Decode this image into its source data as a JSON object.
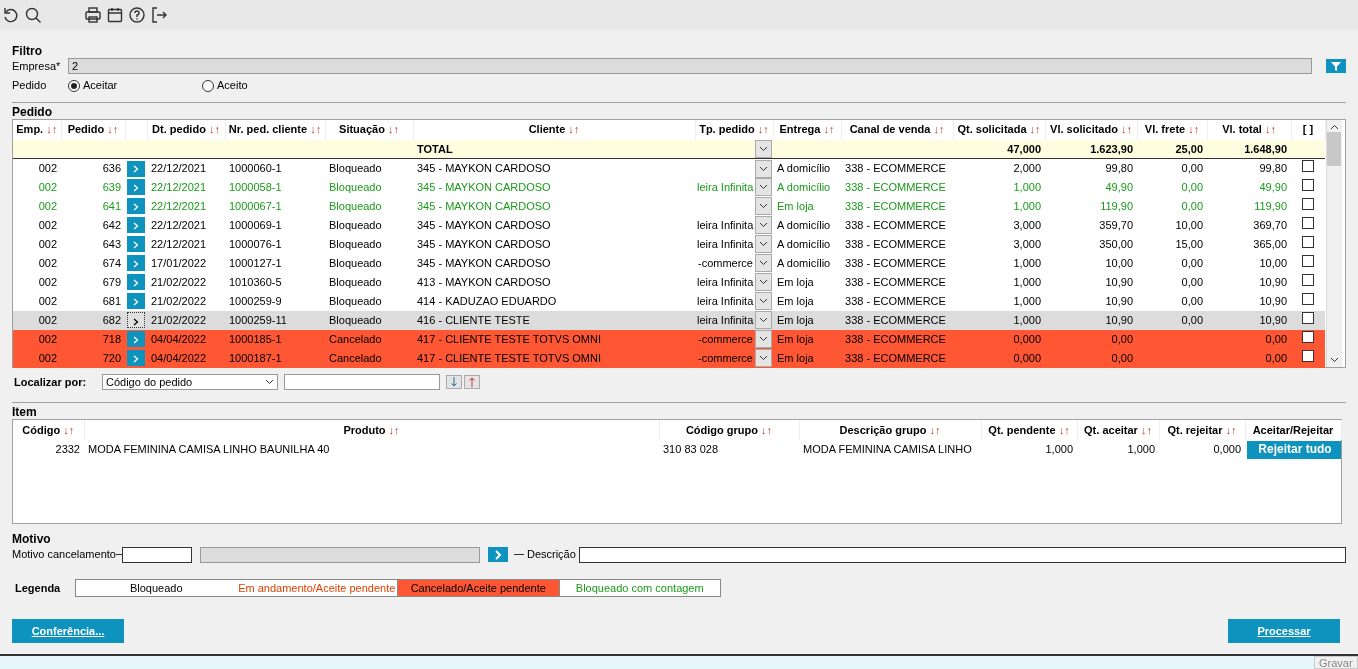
{
  "filter": {
    "title": "Filtro",
    "empresa_label": "Empresa*",
    "empresa_value": "2",
    "pedido_label": "Pedido",
    "options": [
      {
        "label": "Aceitar",
        "selected": true
      },
      {
        "label": "Aceito",
        "selected": false
      }
    ]
  },
  "pedido": {
    "title": "Pedido",
    "columns": [
      {
        "label": "Emp.",
        "sort": "↓↑"
      },
      {
        "label": "Pedido",
        "sort": "↓↑"
      },
      {},
      {
        "label": "Dt. pedido",
        "sort": "↓↑"
      },
      {
        "label": "Nr. ped. cliente",
        "sort": "↓↑"
      },
      {
        "label": "Situação",
        "sort": "↓↑"
      },
      {
        "label": "Cliente",
        "sort": "↓↑"
      },
      {
        "label": "Tp. pedido",
        "sort": "↓↑"
      },
      {
        "label": "Entrega",
        "sort": "↓↑"
      },
      {
        "label": "Canal de venda",
        "sort": "↓↑"
      },
      {
        "label": "Qt. solicitada",
        "sort": "↓↑"
      },
      {
        "label": "Vl. solicitado",
        "sort": "↓↑"
      },
      {
        "label": "Vl. frete",
        "sort": "↓↑"
      },
      {
        "label": "Vl. total",
        "sort": "↓↑"
      },
      {
        "label": "[ ]"
      }
    ],
    "total": {
      "label": "TOTAL",
      "qt": "47,000",
      "vl": "1.623,90",
      "frete": "25,00",
      "total": "1.648,90"
    },
    "rows": [
      {
        "kind": "bloqueado",
        "selected": false,
        "checked": false,
        "emp": "002",
        "pedido": "636",
        "dt": "22/12/2021",
        "nr": "1000060-1",
        "situacao": "Bloqueado",
        "cliente": "345 - MAYKON CARDOSO",
        "entrega": "A domicílio",
        "canal": "338 - ECOMMERCE",
        "qt": "2,000",
        "vl": "99,80",
        "frete": "0,00",
        "total": "99,80"
      },
      {
        "kind": "contagem",
        "selected": false,
        "checked": false,
        "emp": "002",
        "pedido": "639",
        "dt": "22/12/2021",
        "nr": "1000058-1",
        "situacao": "Bloqueado",
        "cliente": "345 - MAYKON CARDOSO",
        "tp": "leira Infinita",
        "entrega": "A domicílio",
        "canal": "338 - ECOMMERCE",
        "qt": "1,000",
        "vl": "49,90",
        "frete": "0,00",
        "total": "49,90"
      },
      {
        "kind": "contagem",
        "selected": false,
        "checked": false,
        "emp": "002",
        "pedido": "641",
        "dt": "22/12/2021",
        "nr": "1000067-1",
        "situacao": "Bloqueado",
        "cliente": "345 - MAYKON CARDOSO",
        "entrega": "Em loja",
        "canal": "338 - ECOMMERCE",
        "qt": "1,000",
        "vl": "119,90",
        "frete": "0,00",
        "total": "119,90"
      },
      {
        "kind": "bloqueado",
        "selected": false,
        "checked": false,
        "emp": "002",
        "pedido": "642",
        "dt": "22/12/2021",
        "nr": "1000069-1",
        "situacao": "Bloqueado",
        "cliente": "345 - MAYKON CARDOSO",
        "tp": "leira Infinita",
        "entrega": "A domicílio",
        "canal": "338 - ECOMMERCE",
        "qt": "3,000",
        "vl": "359,70",
        "frete": "10,00",
        "total": "369,70"
      },
      {
        "kind": "bloqueado",
        "selected": false,
        "checked": false,
        "emp": "002",
        "pedido": "643",
        "dt": "22/12/2021",
        "nr": "1000076-1",
        "situacao": "Bloqueado",
        "cliente": "345 - MAYKON CARDOSO",
        "tp": "leira Infinita",
        "entrega": "A domicílio",
        "canal": "338 - ECOMMERCE",
        "qt": "3,000",
        "vl": "350,00",
        "frete": "15,00",
        "total": "365,00"
      },
      {
        "kind": "bloqueado",
        "selected": false,
        "checked": false,
        "emp": "002",
        "pedido": "674",
        "dt": "17/01/2022",
        "nr": "1000127-1",
        "situacao": "Bloqueado",
        "cliente": "345 - MAYKON CARDOSO",
        "tp": "-commerce",
        "entrega": "A domicílio",
        "canal": "338 - ECOMMERCE",
        "qt": "1,000",
        "vl": "10,00",
        "frete": "0,00",
        "total": "10,00"
      },
      {
        "kind": "bloqueado",
        "selected": false,
        "checked": false,
        "emp": "002",
        "pedido": "679",
        "dt": "21/02/2022",
        "nr": "1010360-5",
        "situacao": "Bloqueado",
        "cliente": "413 - MAYKON CARDOSO",
        "tp": "leira Infinita",
        "entrega": "Em loja",
        "canal": "338 - ECOMMERCE",
        "qt": "1,000",
        "vl": "10,90",
        "frete": "0,00",
        "total": "10,90"
      },
      {
        "kind": "bloqueado",
        "selected": false,
        "checked": false,
        "emp": "002",
        "pedido": "681",
        "dt": "21/02/2022",
        "nr": "1000259-9",
        "situacao": "Bloqueado",
        "cliente": "414 - KADUZAO EDUARDO",
        "tp": "leira Infinita",
        "entrega": "Em loja",
        "canal": "338 - ECOMMERCE",
        "qt": "1,000",
        "vl": "10,90",
        "frete": "0,00",
        "total": "10,90"
      },
      {
        "kind": "bloqueado",
        "selected": true,
        "checked": false,
        "emp": "002",
        "pedido": "682",
        "dt": "21/02/2022",
        "nr": "1000259-11",
        "situacao": "Bloqueado",
        "cliente": "416 - CLIENTE TESTE",
        "tp": "leira Infinita",
        "entrega": "Em loja",
        "canal": "338 - ECOMMERCE",
        "qt": "1,000",
        "vl": "10,90",
        "frete": "0,00",
        "total": "10,90"
      },
      {
        "kind": "cancelado",
        "selected": false,
        "checked": false,
        "emp": "002",
        "pedido": "718",
        "dt": "04/04/2022",
        "nr": "1000185-1",
        "situacao": "Cancelado",
        "cliente": "417 - CLIENTE TESTE TOTVS OMNI",
        "tp": "-commerce",
        "entrega": "Em loja",
        "canal": "338 - ECOMMERCE",
        "qt": "0,000",
        "vl": "0,00",
        "total": "0,00"
      },
      {
        "kind": "cancelado",
        "selected": false,
        "checked": false,
        "emp": "002",
        "pedido": "720",
        "dt": "04/04/2022",
        "nr": "1000187-1",
        "situacao": "Cancelado",
        "cliente": "417 - CLIENTE TESTE TOTVS OMNI",
        "tp": "-commerce",
        "entrega": "Em loja",
        "canal": "338 - ECOMMERCE",
        "qt": "0,000",
        "vl": "0,00",
        "total": "0,00"
      }
    ]
  },
  "localizar": {
    "label": "Localizar por:",
    "select_value": "Código do pedido"
  },
  "item": {
    "title": "Item",
    "columns": [
      {
        "label": "Código",
        "sort": "↓↑"
      },
      {
        "label": "Produto",
        "sort": "↓↑"
      },
      {
        "label": "Código grupo",
        "sort": "↓↑"
      },
      {
        "label": "Descrição grupo",
        "sort": "↓↑"
      },
      {
        "label": "Qt. pendente",
        "sort": "↓↑"
      },
      {
        "label": "Qt. aceitar",
        "sort": "↓↑"
      },
      {
        "label": "Qt. rejeitar",
        "sort": "↓↑"
      },
      {
        "label": "Aceitar/Rejeitar"
      }
    ],
    "rows": [
      {
        "codigo": "2332",
        "produto": "MODA FEMININA CAMISA LINHO BAUNILHA 40",
        "grupo": "310 83 028",
        "descricao": "MODA FEMININA CAMISA LINHO",
        "pendente": "1,000",
        "aceitar": "1,000",
        "rejeitar": "0,000",
        "action": "Rejeitar tudo"
      }
    ]
  },
  "motivo": {
    "title": "Motivo",
    "label": "Motivo cancelamento",
    "descricao_label": "Descrição"
  },
  "legenda": {
    "title": "Legenda",
    "items": [
      {
        "kind": "bloqueado",
        "label": "Bloqueado"
      },
      {
        "kind": "andamento",
        "label": "Em andamento/Aceite pendente"
      },
      {
        "kind": "cancelado",
        "label": "Cancelado/Aceite pendente"
      },
      {
        "kind": "contagem",
        "label": "Bloqueado com contagem"
      }
    ]
  },
  "buttons": {
    "left": "Conferência...",
    "right": "Processar"
  },
  "status_bar": {
    "action": "Gravar"
  }
}
